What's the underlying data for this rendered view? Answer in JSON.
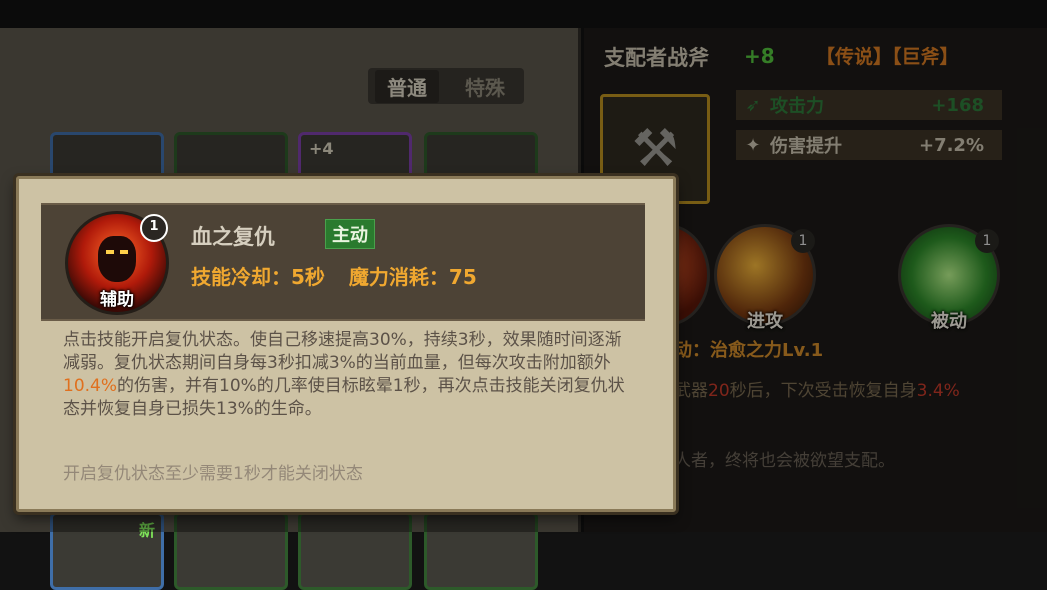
{
  "inventory": {
    "tabs": [
      "普通",
      "特殊"
    ],
    "active_tab": "普通",
    "slot_badges": {
      "plus": "+4",
      "new": "新"
    }
  },
  "item": {
    "name": "支配者战斧",
    "enhance": "+8",
    "tags": "【传说】【巨斧】",
    "stats": [
      {
        "icon": "attack-icon",
        "label": "攻击力",
        "value": "+168"
      },
      {
        "icon": "damage-boost-icon",
        "label": "伤害提升",
        "value": "+7.2%"
      }
    ],
    "skill_orbs": [
      {
        "label": "进攻",
        "level": "1"
      },
      {
        "label": "被动",
        "level": "1"
      }
    ],
    "passive_text": "动：治愈之力Lv.1",
    "weapon_effect_prefix": "武器",
    "weapon_effect_seconds": "20",
    "weapon_effect_mid": "秒后，下次受击恢复自身",
    "weapon_effect_pct": "3.4%",
    "flavor": "人者，终将也会被欲望支配。"
  },
  "tooltip": {
    "skill_name": "血之复仇",
    "skill_type": "主动",
    "skill_level": "1",
    "skill_category": "辅助",
    "cooldown": "技能冷却：5秒",
    "mana_cost": "魔力消耗：75",
    "desc_part1": "点击技能开启复仇状态。使自己移速提高30%，持续3秒，效果随时间逐渐减弱。复仇状态期间自身每3秒扣减3%的当前血量，但每次攻击附加额外",
    "desc_highlight": "10.4%",
    "desc_part2": "的伤害，并有10%的几率使目标眩晕1秒，再次点击技能关闭复仇状态并恢复自身已损失13%的生命。",
    "note": "开启复仇状态至少需要1秒才能关闭状态"
  },
  "colors": {
    "tooltip_bg": "#cdc2a4",
    "header_bg": "#4d4336",
    "stat_orange": "#f0a830",
    "highlight": "#e0701e",
    "active_green": "#2a7a2e"
  }
}
